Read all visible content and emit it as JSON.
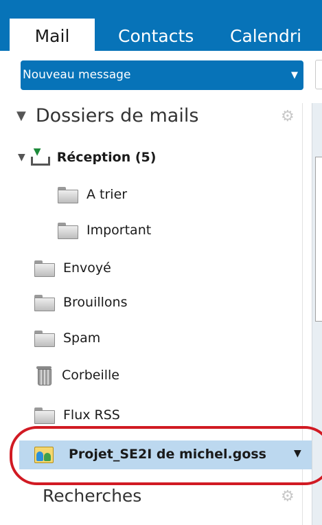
{
  "tabs": [
    {
      "label": "Mail"
    },
    {
      "label": "Contacts"
    },
    {
      "label": "Calendri"
    }
  ],
  "new_message": {
    "label": "Nouveau message"
  },
  "mail_folders": {
    "header": "Dossiers de mails",
    "inbox": {
      "label": "Réception (5)"
    },
    "subfolders": [
      {
        "label": "A trier"
      },
      {
        "label": "Important"
      }
    ],
    "folders": [
      {
        "label": "Envoyé",
        "icon": "sent-folder-icon"
      },
      {
        "label": "Brouillons",
        "icon": "drafts-folder-icon"
      },
      {
        "label": "Spam",
        "icon": "spam-folder-icon"
      },
      {
        "label": "Corbeille",
        "icon": "trash-icon"
      },
      {
        "label": "Flux RSS",
        "icon": "folder-icon"
      }
    ],
    "shared": {
      "label": "Projet_SE2I de michel.goss"
    }
  },
  "searches": {
    "header": "Recherches"
  },
  "colors": {
    "brand": "#0773b8",
    "selected_row": "#bcd8ef",
    "annotation_red": "#d11a23"
  }
}
